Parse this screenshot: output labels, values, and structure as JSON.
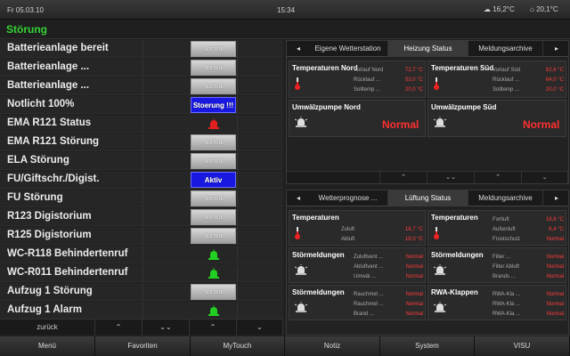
{
  "status": {
    "date": "Fr 05.03.10",
    "time": "15:34",
    "weather_out": "16,2°C",
    "weather_in": "20,1°C"
  },
  "title": "Störung",
  "rows": [
    {
      "label": "Batterieanlage bereit",
      "ctrl": "btn",
      "text": "Normal"
    },
    {
      "label": "Batterieanlage ...",
      "ctrl": "btn",
      "text": "Normal"
    },
    {
      "label": "Batterieanlage ...",
      "ctrl": "btn",
      "text": "Normal"
    },
    {
      "label": "Notlicht 100%",
      "ctrl": "blue",
      "text": "Stoerung !!!"
    },
    {
      "label": "EMA R121 Status",
      "ctrl": "lamp-red",
      "text": ""
    },
    {
      "label": "EMA R121 Störung",
      "ctrl": "btn",
      "text": "Normal"
    },
    {
      "label": "ELA Störung",
      "ctrl": "btn",
      "text": "Normal"
    },
    {
      "label": "FU/Giftschr./Digist.",
      "ctrl": "blue",
      "text": "Aktiv"
    },
    {
      "label": "FU Störung",
      "ctrl": "btn",
      "text": "Normal"
    },
    {
      "label": "R123 Digistorium",
      "ctrl": "btn",
      "text": "Normal"
    },
    {
      "label": "R125 Digistorium",
      "ctrl": "btn",
      "text": "Normal"
    },
    {
      "label": "WC-R118 Behindertenruf",
      "ctrl": "lamp-green",
      "text": ""
    },
    {
      "label": "WC-R011 Behindertenruf",
      "ctrl": "lamp-green",
      "text": ""
    },
    {
      "label": "Aufzug 1 Störung",
      "ctrl": "btn",
      "text": "Normal"
    },
    {
      "label": "Aufzug 1 Alarm",
      "ctrl": "lamp-green",
      "text": ""
    }
  ],
  "left_nav": {
    "back": "zurück",
    "up": "⌃",
    "down2": "⌄⌄",
    "up2": "⌃",
    "down": "⌄"
  },
  "panel1": {
    "tabs": [
      "◂",
      "Eigene Wetterstation",
      "Heizung Status",
      "Meldungsarchive",
      "▸"
    ],
    "box_a": {
      "title": "Temperaturen Nord",
      "keys": [
        "Vorlauf Nord",
        "Rücklauf ...",
        "Solltemp ..."
      ],
      "vals": [
        "72,7 °C",
        "53,0 °C",
        "20,0 °C"
      ]
    },
    "box_b": {
      "title": "Temperaturen Süd",
      "keys": [
        "Vorlauf Süd",
        "Rücklauf ...",
        "Solltemp ..."
      ],
      "vals": [
        "82,6 °C",
        "64,0 °C",
        "20,0 °C"
      ]
    },
    "box_c": {
      "title": "Umwälzpumpe Nord",
      "state": "Normal"
    },
    "box_d": {
      "title": "Umwälzpumpe Süd",
      "state": "Normal"
    }
  },
  "panel2": {
    "tabs": [
      "◂",
      "Wetterprognose ...",
      "Lüftung Status",
      "Meldungsarchive",
      "▸"
    ],
    "box_a": {
      "title": "Temperaturen",
      "keys": [
        "Zuluft",
        "Abluft"
      ],
      "vals": [
        "18,7 °C",
        "18,0 °C"
      ]
    },
    "box_b": {
      "title": "Temperaturen",
      "keys": [
        "Fortluft",
        "Außenluft",
        "Frostschutz"
      ],
      "vals": [
        "18,6 °C",
        "6,4 °C",
        "Normal"
      ]
    },
    "box_c": {
      "title": "Störmeldungen",
      "keys": [
        "Zuluftvent ...",
        "Abluftvent ...",
        "Umwäl ..."
      ],
      "vals": [
        "Normal",
        "Normal",
        "Normal"
      ]
    },
    "box_d": {
      "title": "Störmeldungen",
      "keys": [
        "Filter ...",
        "Filter Abluft",
        "Brands ..."
      ],
      "vals": [
        "Normal",
        "Normal",
        "Normal"
      ]
    },
    "box_e": {
      "title": "Störmeldungen",
      "keys": [
        "Rauchmel ...",
        "Rauchmel ...",
        "Brand ..."
      ],
      "vals": [
        "Normal",
        "Normal",
        "Normal"
      ]
    },
    "box_f": {
      "title": "RWA-Klappen",
      "keys": [
        "RWA-Kla ...",
        "RWA-Kla ...",
        "RWA-Kla ..."
      ],
      "vals": [
        "Normal",
        "Normal",
        "Normal"
      ]
    }
  },
  "bottom": [
    "Menü",
    "Favoriten",
    "MyTouch",
    "Notiz",
    "System",
    "VISU"
  ]
}
